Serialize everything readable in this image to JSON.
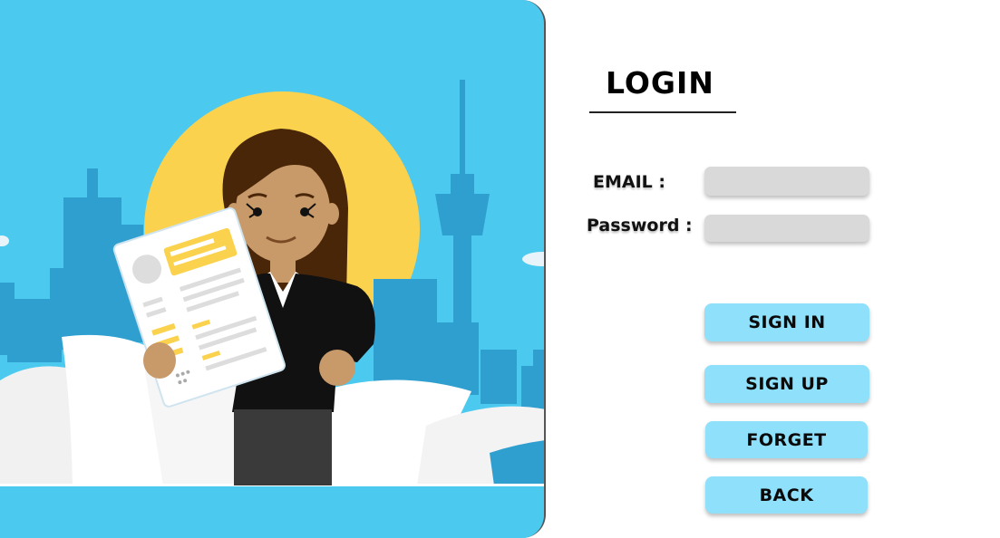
{
  "login": {
    "title": "LOGIN",
    "email_label": "EMAIL :",
    "password_label": "Password :",
    "email_value": "",
    "password_value": ""
  },
  "buttons": {
    "sign_in": "SIGN IN",
    "sign_up": "SIGN UP",
    "forget": "FORGET",
    "back": "BACK"
  },
  "colors": {
    "panel_background": "#4bc9ef",
    "sun": "#fbd24e",
    "button_background": "#8fe0fb",
    "input_background": "#d9d9d9"
  }
}
